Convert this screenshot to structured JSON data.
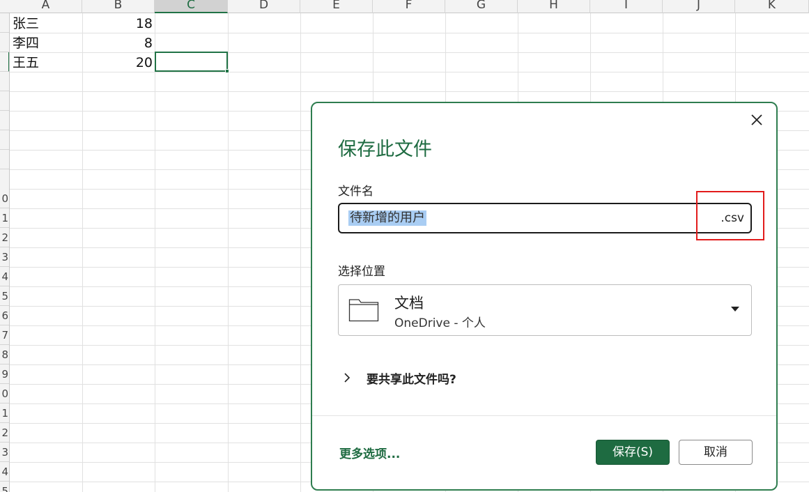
{
  "sheet": {
    "columns": [
      "A",
      "B",
      "C",
      "D",
      "E",
      "F",
      "G",
      "H",
      "I",
      "J",
      "K"
    ],
    "selected_column": "C",
    "row_numbers_visible": [
      "0",
      "1",
      "2",
      "3",
      "4",
      "5",
      "6",
      "7",
      "8",
      "9",
      "0",
      "1",
      "2",
      "3",
      "4",
      "5"
    ],
    "rows": [
      {
        "name": "张三",
        "value": "18"
      },
      {
        "name": "李四",
        "value": "8"
      },
      {
        "name": "王五",
        "value": "20"
      }
    ]
  },
  "dialog": {
    "title": "保存此文件",
    "filename_label": "文件名",
    "filename_value": "待新增的用户",
    "filename_extension": ".csv",
    "location_label": "选择位置",
    "location_name": "文档",
    "location_sub": "OneDrive - 个人",
    "share_label": "要共享此文件吗?",
    "more_options": "更多选项...",
    "save_button": "保存(S)",
    "cancel_button": "取消",
    "colors": {
      "accent": "#1e6b41",
      "highlight_box": "#e21b1b",
      "selection_bg": "#a9cdf3"
    },
    "icons": {
      "close": "close-icon",
      "folder": "folder-icon",
      "dropdown": "chevron-down-icon",
      "share": "chevron-right-icon"
    }
  }
}
